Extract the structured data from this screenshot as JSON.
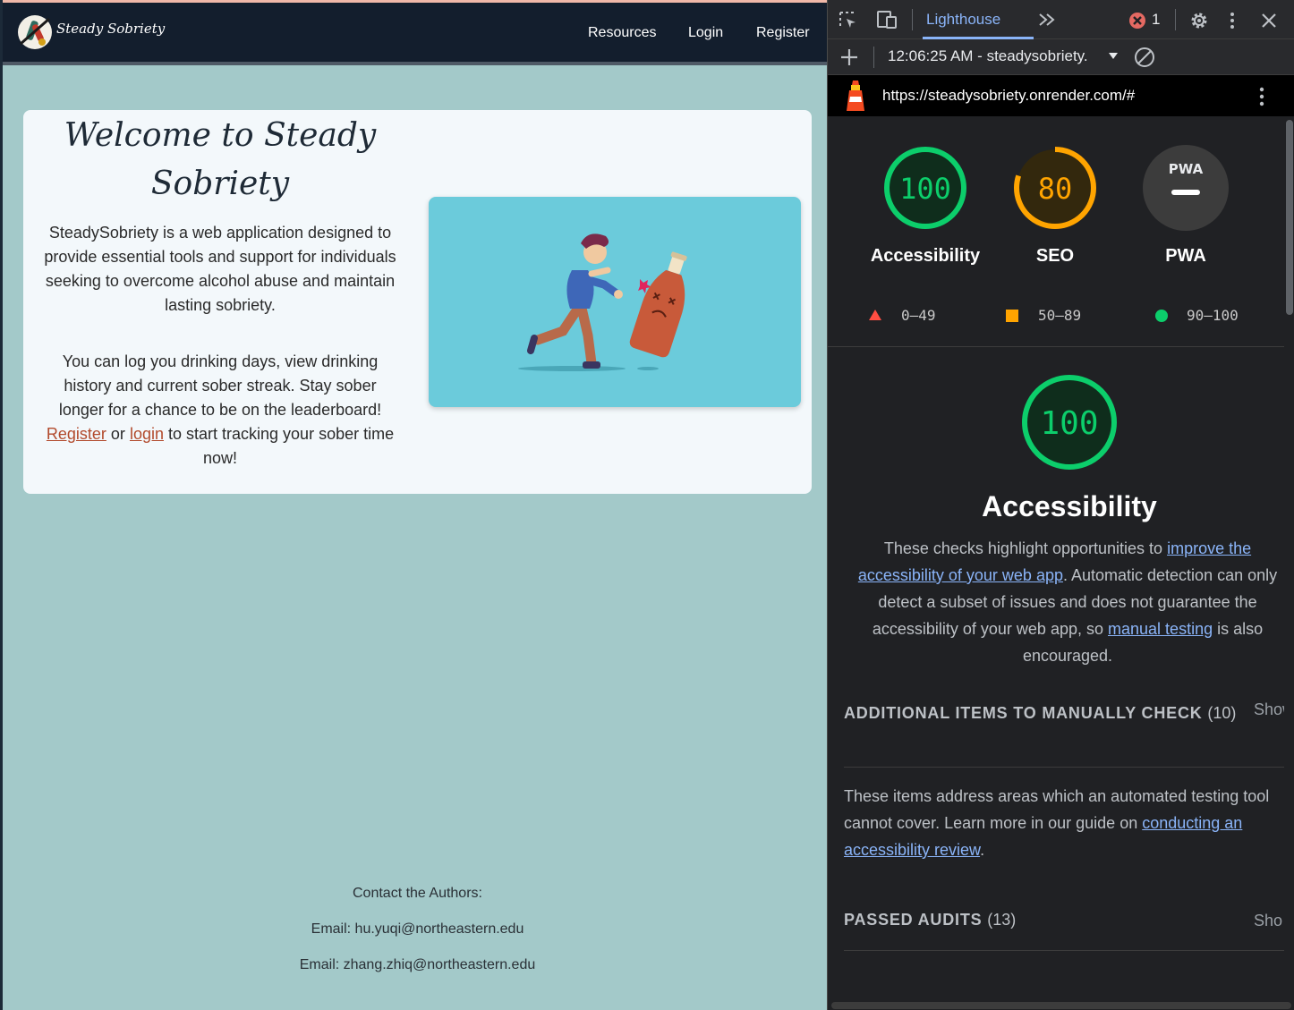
{
  "site": {
    "brand": "Steady Sobriety",
    "nav": [
      "Resources",
      "Login",
      "Register"
    ],
    "title": "Welcome to Steady Sobriety",
    "para1": "SteadySobriety is a web application designed to provide essential tools and support for individuals seeking to overcome alcohol abuse and maintain lasting sobriety.",
    "para2_a": "You can log you drinking days, view drinking history and current sober streak. Stay sober longer for a chance to be on the leaderboard!",
    "register_link": "Register",
    "or": "or",
    "login_link": "login",
    "para2_b": "to start tracking your sober time now!",
    "footer": {
      "heading": "Contact the Authors:",
      "email1": "Email: hu.yuqi@northeastern.edu",
      "email2": "Email: zhang.zhiq@northeastern.edu"
    },
    "colors": {
      "navbar": "#131e2d",
      "background": "#a3c9c9",
      "card": "#f3f8fb",
      "link": "#b24a2c",
      "illustration_bg": "#6bcbdb"
    }
  },
  "devtools": {
    "active_tab": "Lighthouse",
    "more_tabs_icon": "chevron-double-right-icon",
    "error_count": "1",
    "report_selector": "12:06:25 AM - steadysobriety.",
    "url": "https://steadysobriety.onrender.com/#",
    "gauges": [
      {
        "label": "Accessibility",
        "score": "100",
        "color": "#0cce6b",
        "fill": 1.0
      },
      {
        "label": "SEO",
        "score": "80",
        "color": "#ffa400",
        "fill": 0.8
      },
      {
        "label": "PWA",
        "score": "PWA",
        "color": "#e8eaed",
        "fill": 0
      }
    ],
    "legend": [
      {
        "range": "0–49",
        "icon": "red-triangle-icon",
        "color": "#ff4e42"
      },
      {
        "range": "50–89",
        "icon": "orange-square-icon",
        "color": "#ffa400"
      },
      {
        "range": "90–100",
        "icon": "green-circle-icon",
        "color": "#0cce6b"
      }
    ],
    "category": {
      "score": "100",
      "title": "Accessibility",
      "desc_a": "These checks highlight opportunities to",
      "desc_link1": "improve the accessibility of your web app",
      "desc_b": ". Automatic detection can only detect a subset of issues and does not guarantee the accessibility of your web app, so",
      "desc_link2": "manual testing",
      "desc_c": "is also encouraged."
    },
    "manual": {
      "heading": "ADDITIONAL ITEMS TO MANUALLY CHECK",
      "count": "(10)",
      "show": "Show",
      "desc_a": "These items address areas which an automated testing tool cannot cover. Learn more in our guide on",
      "desc_link": "conducting an accessibility review",
      "desc_b": "."
    },
    "passed": {
      "heading": "PASSED AUDITS",
      "count": "(13)",
      "show": "Sho"
    }
  }
}
